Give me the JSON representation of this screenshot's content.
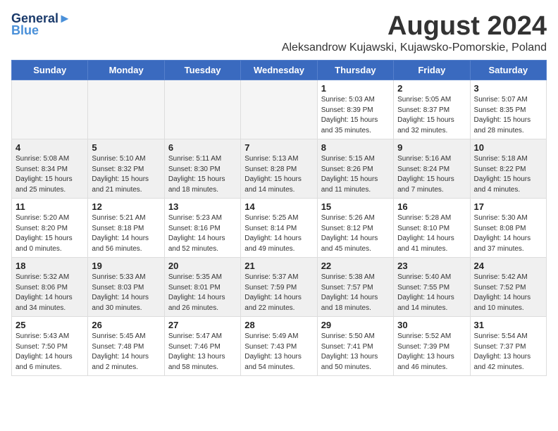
{
  "logo": {
    "line1": "General",
    "line2": "Blue"
  },
  "title": "August 2024",
  "subtitle": "Aleksandrow Kujawski, Kujawsko-Pomorskie, Poland",
  "weekdays": [
    "Sunday",
    "Monday",
    "Tuesday",
    "Wednesday",
    "Thursday",
    "Friday",
    "Saturday"
  ],
  "weeks": [
    [
      {
        "day": "",
        "info": ""
      },
      {
        "day": "",
        "info": ""
      },
      {
        "day": "",
        "info": ""
      },
      {
        "day": "",
        "info": ""
      },
      {
        "day": "1",
        "info": "Sunrise: 5:03 AM\nSunset: 8:39 PM\nDaylight: 15 hours\nand 35 minutes."
      },
      {
        "day": "2",
        "info": "Sunrise: 5:05 AM\nSunset: 8:37 PM\nDaylight: 15 hours\nand 32 minutes."
      },
      {
        "day": "3",
        "info": "Sunrise: 5:07 AM\nSunset: 8:35 PM\nDaylight: 15 hours\nand 28 minutes."
      }
    ],
    [
      {
        "day": "4",
        "info": "Sunrise: 5:08 AM\nSunset: 8:34 PM\nDaylight: 15 hours\nand 25 minutes."
      },
      {
        "day": "5",
        "info": "Sunrise: 5:10 AM\nSunset: 8:32 PM\nDaylight: 15 hours\nand 21 minutes."
      },
      {
        "day": "6",
        "info": "Sunrise: 5:11 AM\nSunset: 8:30 PM\nDaylight: 15 hours\nand 18 minutes."
      },
      {
        "day": "7",
        "info": "Sunrise: 5:13 AM\nSunset: 8:28 PM\nDaylight: 15 hours\nand 14 minutes."
      },
      {
        "day": "8",
        "info": "Sunrise: 5:15 AM\nSunset: 8:26 PM\nDaylight: 15 hours\nand 11 minutes."
      },
      {
        "day": "9",
        "info": "Sunrise: 5:16 AM\nSunset: 8:24 PM\nDaylight: 15 hours\nand 7 minutes."
      },
      {
        "day": "10",
        "info": "Sunrise: 5:18 AM\nSunset: 8:22 PM\nDaylight: 15 hours\nand 4 minutes."
      }
    ],
    [
      {
        "day": "11",
        "info": "Sunrise: 5:20 AM\nSunset: 8:20 PM\nDaylight: 15 hours\nand 0 minutes."
      },
      {
        "day": "12",
        "info": "Sunrise: 5:21 AM\nSunset: 8:18 PM\nDaylight: 14 hours\nand 56 minutes."
      },
      {
        "day": "13",
        "info": "Sunrise: 5:23 AM\nSunset: 8:16 PM\nDaylight: 14 hours\nand 52 minutes."
      },
      {
        "day": "14",
        "info": "Sunrise: 5:25 AM\nSunset: 8:14 PM\nDaylight: 14 hours\nand 49 minutes."
      },
      {
        "day": "15",
        "info": "Sunrise: 5:26 AM\nSunset: 8:12 PM\nDaylight: 14 hours\nand 45 minutes."
      },
      {
        "day": "16",
        "info": "Sunrise: 5:28 AM\nSunset: 8:10 PM\nDaylight: 14 hours\nand 41 minutes."
      },
      {
        "day": "17",
        "info": "Sunrise: 5:30 AM\nSunset: 8:08 PM\nDaylight: 14 hours\nand 37 minutes."
      }
    ],
    [
      {
        "day": "18",
        "info": "Sunrise: 5:32 AM\nSunset: 8:06 PM\nDaylight: 14 hours\nand 34 minutes."
      },
      {
        "day": "19",
        "info": "Sunrise: 5:33 AM\nSunset: 8:03 PM\nDaylight: 14 hours\nand 30 minutes."
      },
      {
        "day": "20",
        "info": "Sunrise: 5:35 AM\nSunset: 8:01 PM\nDaylight: 14 hours\nand 26 minutes."
      },
      {
        "day": "21",
        "info": "Sunrise: 5:37 AM\nSunset: 7:59 PM\nDaylight: 14 hours\nand 22 minutes."
      },
      {
        "day": "22",
        "info": "Sunrise: 5:38 AM\nSunset: 7:57 PM\nDaylight: 14 hours\nand 18 minutes."
      },
      {
        "day": "23",
        "info": "Sunrise: 5:40 AM\nSunset: 7:55 PM\nDaylight: 14 hours\nand 14 minutes."
      },
      {
        "day": "24",
        "info": "Sunrise: 5:42 AM\nSunset: 7:52 PM\nDaylight: 14 hours\nand 10 minutes."
      }
    ],
    [
      {
        "day": "25",
        "info": "Sunrise: 5:43 AM\nSunset: 7:50 PM\nDaylight: 14 hours\nand 6 minutes."
      },
      {
        "day": "26",
        "info": "Sunrise: 5:45 AM\nSunset: 7:48 PM\nDaylight: 14 hours\nand 2 minutes."
      },
      {
        "day": "27",
        "info": "Sunrise: 5:47 AM\nSunset: 7:46 PM\nDaylight: 13 hours\nand 58 minutes."
      },
      {
        "day": "28",
        "info": "Sunrise: 5:49 AM\nSunset: 7:43 PM\nDaylight: 13 hours\nand 54 minutes."
      },
      {
        "day": "29",
        "info": "Sunrise: 5:50 AM\nSunset: 7:41 PM\nDaylight: 13 hours\nand 50 minutes."
      },
      {
        "day": "30",
        "info": "Sunrise: 5:52 AM\nSunset: 7:39 PM\nDaylight: 13 hours\nand 46 minutes."
      },
      {
        "day": "31",
        "info": "Sunrise: 5:54 AM\nSunset: 7:37 PM\nDaylight: 13 hours\nand 42 minutes."
      }
    ]
  ]
}
